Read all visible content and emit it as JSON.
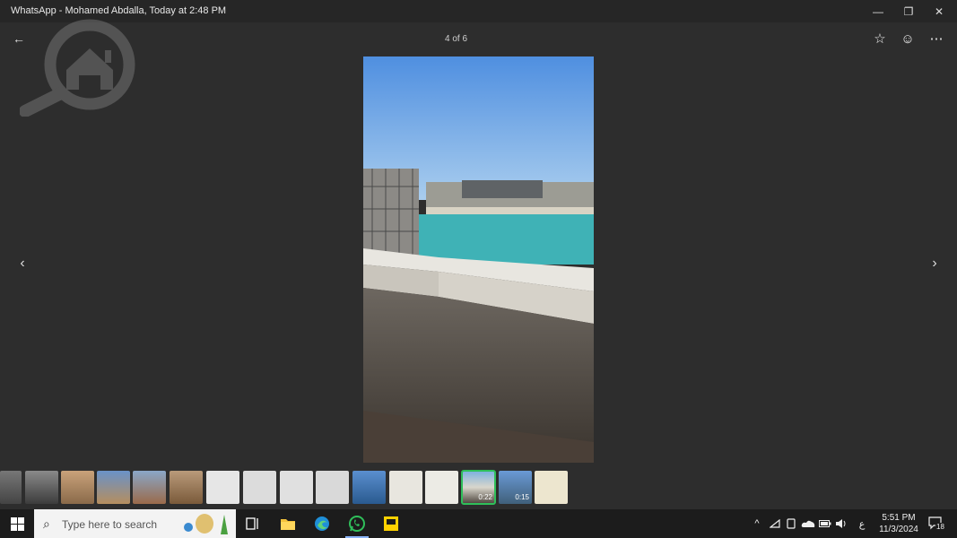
{
  "window": {
    "title": "WhatsApp - Mohamed Abdalla, Today at 2:48 PM",
    "minimize_glyph": "—",
    "restore_glyph": "❐",
    "close_glyph": "✕"
  },
  "viewer": {
    "back_glyph": "←",
    "counter": "4 of 6",
    "star_glyph": "☆",
    "react_glyph": "☺",
    "more_glyph": "⋯",
    "prev_glyph": "‹",
    "next_glyph": "›"
  },
  "icons": {
    "watermark": "magnifier-house-icon",
    "back": "arrow-left-icon",
    "star": "star-icon",
    "react": "emoji-icon",
    "more": "more-icon",
    "prev": "chevron-left-icon",
    "next": "chevron-right-icon"
  },
  "thumbnails": [
    {
      "duration": ""
    },
    {
      "duration": ""
    },
    {
      "duration": ""
    },
    {
      "duration": ""
    },
    {
      "duration": ""
    },
    {
      "duration": ""
    },
    {
      "duration": ""
    },
    {
      "duration": ""
    },
    {
      "duration": ""
    },
    {
      "duration": ""
    },
    {
      "duration": ""
    },
    {
      "duration": ""
    },
    {
      "duration": ""
    },
    {
      "duration": "0:22"
    },
    {
      "duration": "0:15"
    },
    {
      "duration": ""
    }
  ],
  "taskbar": {
    "search_placeholder": "Type here to search",
    "search_glyph": "⌕",
    "tray_chevron": "^",
    "ime_indicator": "ع",
    "time": "5:51 PM",
    "date": "11/3/2024",
    "notification_count": "18"
  },
  "colors": {
    "background": "#2d2d2d",
    "whatsapp_green": "#2fbf5a",
    "sticky_yellow": "#ffd200",
    "edge_blue": "#1f8fd8"
  }
}
